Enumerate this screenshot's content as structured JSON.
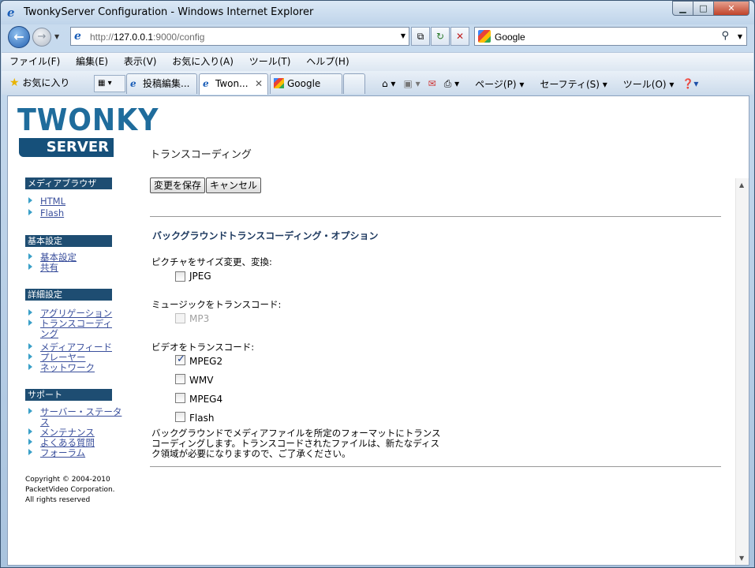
{
  "window": {
    "title": "TwonkyServer Configuration - Windows Internet Explorer"
  },
  "address": {
    "url_prefix": "http://",
    "url_host": "127.0.0.1",
    "url_rest": ":9000/config"
  },
  "search": {
    "provider": "Google"
  },
  "menu": [
    "ファイル(F)",
    "編集(E)",
    "表示(V)",
    "お気に入り(A)",
    "ツール(T)",
    "ヘルプ(H)"
  ],
  "favorites_label": "お気に入り",
  "tabs": [
    {
      "label": "投稿編集...",
      "icon": "ie-icon"
    },
    {
      "label": "Twon...",
      "icon": "ie-icon",
      "active": true
    },
    {
      "label": "Google",
      "icon": "google-icon"
    }
  ],
  "commands": {
    "page": "ページ(P)",
    "safety": "セーフティ(S)",
    "tools": "ツール(O)"
  },
  "logo": {
    "top": "TWONKY",
    "tm": "™",
    "bottom": "SERVER"
  },
  "sidebar": {
    "sections": [
      {
        "title": "メディアブラウザ",
        "items": [
          "HTML",
          "Flash"
        ]
      },
      {
        "title": "基本設定",
        "items": [
          "基本設定",
          "共有"
        ]
      },
      {
        "title": "詳細設定",
        "items": [
          "アグリゲーション",
          "トランスコーディング",
          "メディアフィード",
          "プレーヤー",
          "ネットワーク"
        ]
      },
      {
        "title": "サポート",
        "items": [
          "サーバー・ステータス",
          "メンテナンス",
          "よくある質問",
          "フォーラム"
        ]
      }
    ],
    "copyright": [
      "Copyright © 2004-2010",
      "PacketVideo Corporation.",
      "All rights reserved"
    ]
  },
  "main": {
    "title": "トランスコーディング",
    "save_button": "変更を保存",
    "cancel_button": "キャンセル",
    "subtitle": "バックグラウンドトランスコーディング・オプション",
    "picture_label": "ピクチャをサイズ変更、変換:",
    "picture_options": [
      {
        "label": "JPEG",
        "checked": false
      }
    ],
    "music_label": "ミュージックをトランスコード:",
    "music_options": [
      {
        "label": "MP3",
        "checked": false,
        "disabled": true
      }
    ],
    "video_label": "ビデオをトランスコード:",
    "video_options": [
      {
        "label": "MPEG2",
        "checked": true
      },
      {
        "label": "WMV",
        "checked": false
      },
      {
        "label": "MPEG4",
        "checked": false
      },
      {
        "label": "Flash",
        "checked": false
      }
    ],
    "note": "バックグラウンドでメディアファイルを所定のフォーマットにトランスコーディングします。トランスコードされたファイルは、新たなディスク領域が必要になりますので、ご了承ください。"
  }
}
